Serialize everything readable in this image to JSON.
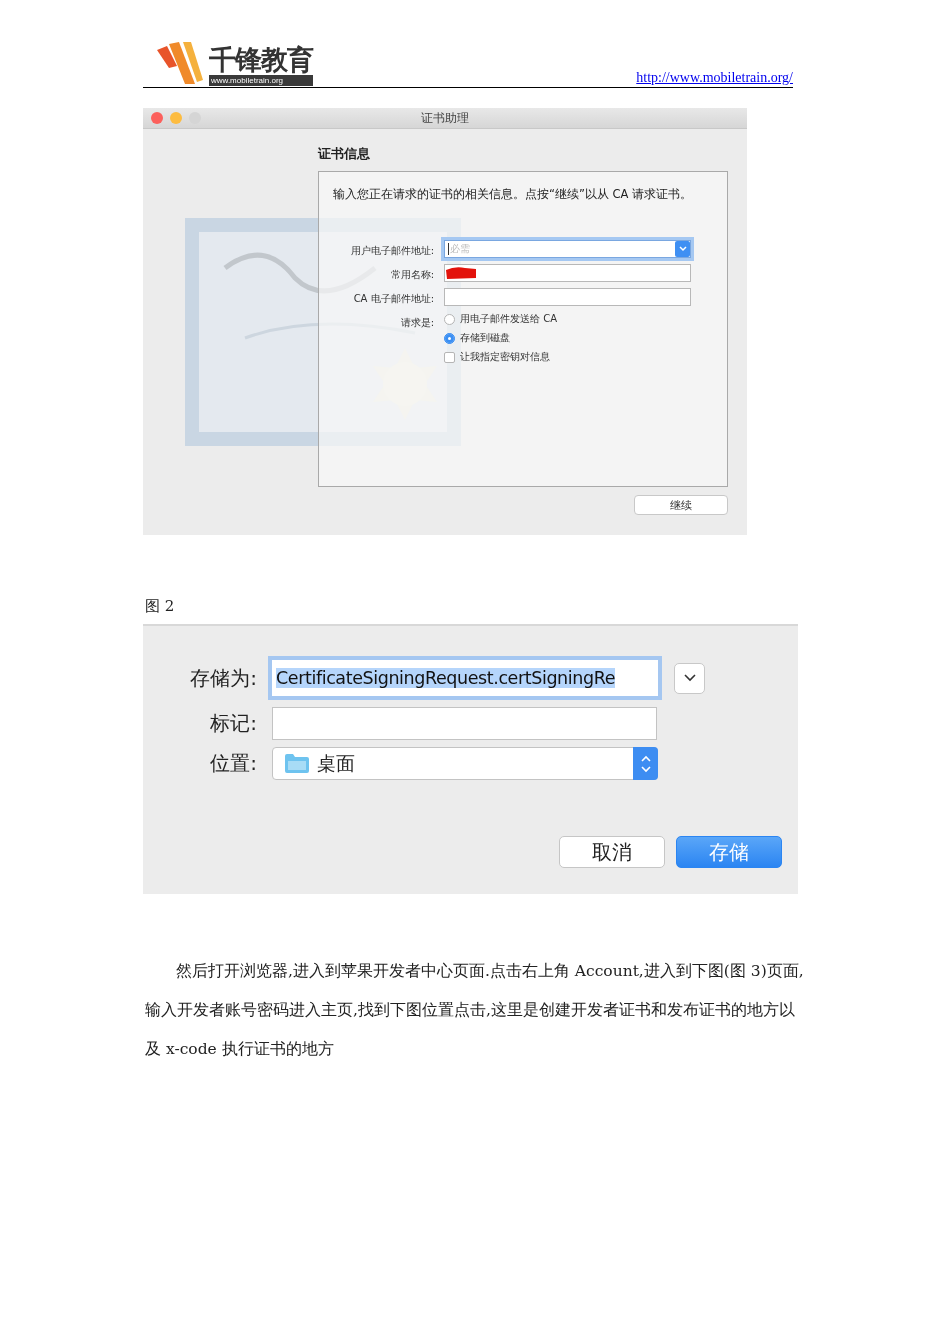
{
  "header": {
    "logo_name": "千锋教育",
    "logo_url": "www.mobiletrain.org",
    "link": "http://www.mobiletrain.org/"
  },
  "assistant": {
    "title": "证书助理",
    "heading": "证书信息",
    "description": "输入您正在请求的证书的相关信息。点按“继续”以从 CA 请求证书。",
    "fields": [
      {
        "label": "用户电子邮件地址:",
        "placeholder": "必需",
        "focused": true,
        "redacted": false
      },
      {
        "label": "常用名称:",
        "focused": false,
        "redacted": true
      },
      {
        "label": "CA 电子邮件地址:",
        "focused": false,
        "redacted": false
      }
    ],
    "request_label": "请求是:",
    "options": [
      {
        "kind": "radio",
        "label": "用电子邮件发送给 CA",
        "selected": false
      },
      {
        "kind": "radio",
        "label": "存储到磁盘",
        "selected": true
      },
      {
        "kind": "checkbox",
        "label": "让我指定密钥对信息",
        "checked": false
      }
    ],
    "continue": "继续"
  },
  "caption": "图 2",
  "save_dialog": {
    "save_as_label": "存储为:",
    "save_as_value": "CertificateSigningRequest.certSigningRe",
    "tags_label": "标记:",
    "location_label": "位置:",
    "location_value": "桌面",
    "buttons": [
      {
        "label": "取消",
        "kind": "normal"
      },
      {
        "label": "存储",
        "kind": "primary"
      }
    ]
  },
  "paragraph": "然后打开浏览器,进入到苹果开发者中心页面.点击右上角 Account,进入到下图(图 3)页面,输入开发者账号密码进入主页,找到下图位置点击,这里是创建开发者证书和发布证书的地方以及 x-code 执行证书的地方"
}
